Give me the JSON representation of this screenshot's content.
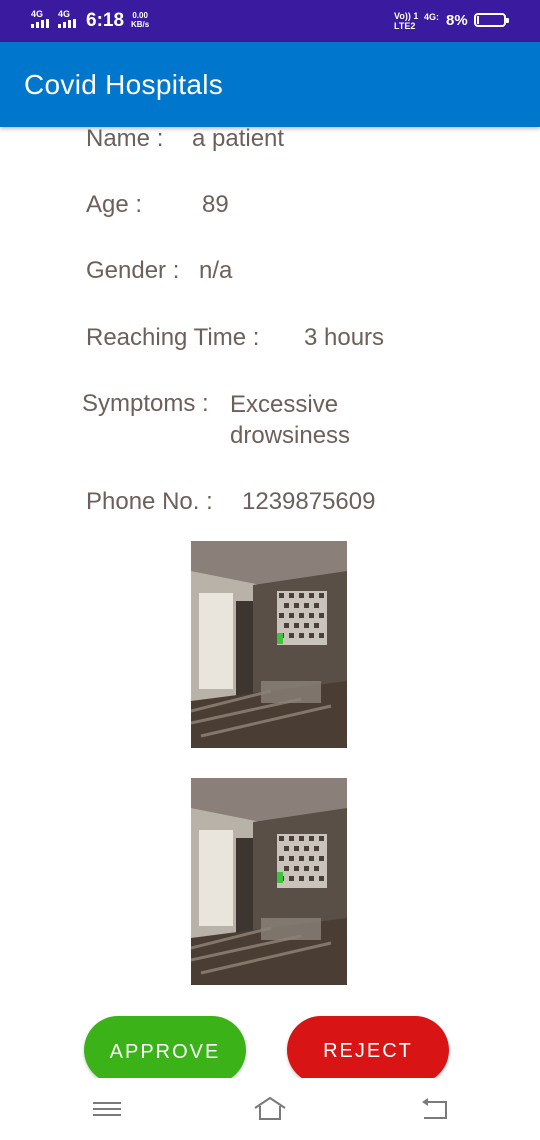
{
  "status_bar": {
    "sim1": "4G",
    "sim2": "4G",
    "time": "6:18",
    "speed_value": "0.00",
    "speed_unit": "KB/s",
    "volte_top": "Vo)) 1",
    "volte_bottom": "LTE2",
    "network": "4G:",
    "battery_percent": "8%",
    "battery_level": 0.08
  },
  "app_bar": {
    "title": "Covid Hospitals"
  },
  "details": {
    "name_label": "Name :",
    "name_value": "a patient",
    "age_label": "Age :",
    "age_value": "89",
    "gender_label": "Gender :",
    "gender_value": "n/a",
    "reaching_label": "Reaching Time :",
    "reaching_value": "3 hours",
    "symptoms_label": "Symptoms :",
    "symptoms_value": "Excessive drowsiness",
    "phone_label": "Phone No. :",
    "phone_value": "1239875609"
  },
  "actions": {
    "approve_label": "APPROVE",
    "reject_label": "REJECT"
  },
  "icons": {
    "nav_menu": "menu-icon",
    "nav_home": "home-icon",
    "nav_back": "back-icon"
  },
  "colors": {
    "status_bar": "#3a1a9e",
    "app_bar": "#0077cc",
    "approve": "#3bb318",
    "reject": "#d81414",
    "text": "#6d5f5c"
  }
}
